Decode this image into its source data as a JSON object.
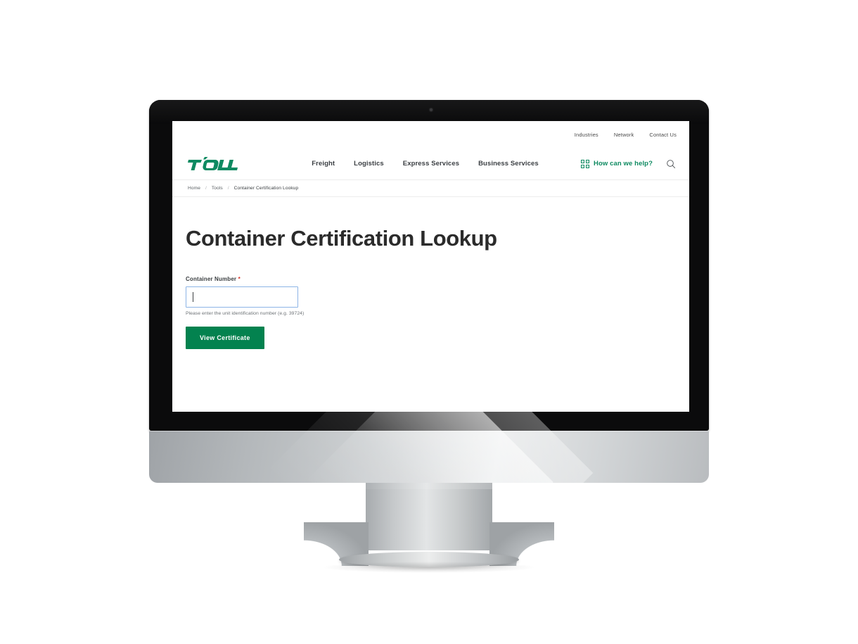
{
  "browser_mockup": {
    "device": "desktop-monitor",
    "webcam_icon": "camera-dot-icon"
  },
  "site": {
    "brand": "TOLL",
    "brand_color": "#0e8a61",
    "accent_green": "#03824f",
    "focus_border_color": "#8cb4e6",
    "required_color": "#d93025"
  },
  "utility_nav": {
    "items": [
      {
        "label": "Industries",
        "name": "utility-link-industries"
      },
      {
        "label": "Network",
        "name": "utility-link-network"
      },
      {
        "label": "Contact Us",
        "name": "utility-link-contact-us"
      }
    ]
  },
  "main_nav": {
    "items": [
      {
        "label": "Freight"
      },
      {
        "label": "Logistics"
      },
      {
        "label": "Express Services"
      },
      {
        "label": "Business Services"
      }
    ],
    "help_label": "How can we help?",
    "help_icon": "grid-2x2-icon",
    "search_icon": "search-icon"
  },
  "breadcrumb": {
    "separator": "/",
    "items": [
      {
        "label": "Home"
      },
      {
        "label": "Tools"
      },
      {
        "label": "Container Certification Lookup"
      }
    ]
  },
  "main": {
    "title": "Container Certification Lookup",
    "form": {
      "field_label": "Container Number",
      "required_marker": "*",
      "input_value": "",
      "input_placeholder": "",
      "help_text": "Please enter the unit identification number (e.g. 39724)",
      "submit_label": "View Certificate"
    }
  }
}
